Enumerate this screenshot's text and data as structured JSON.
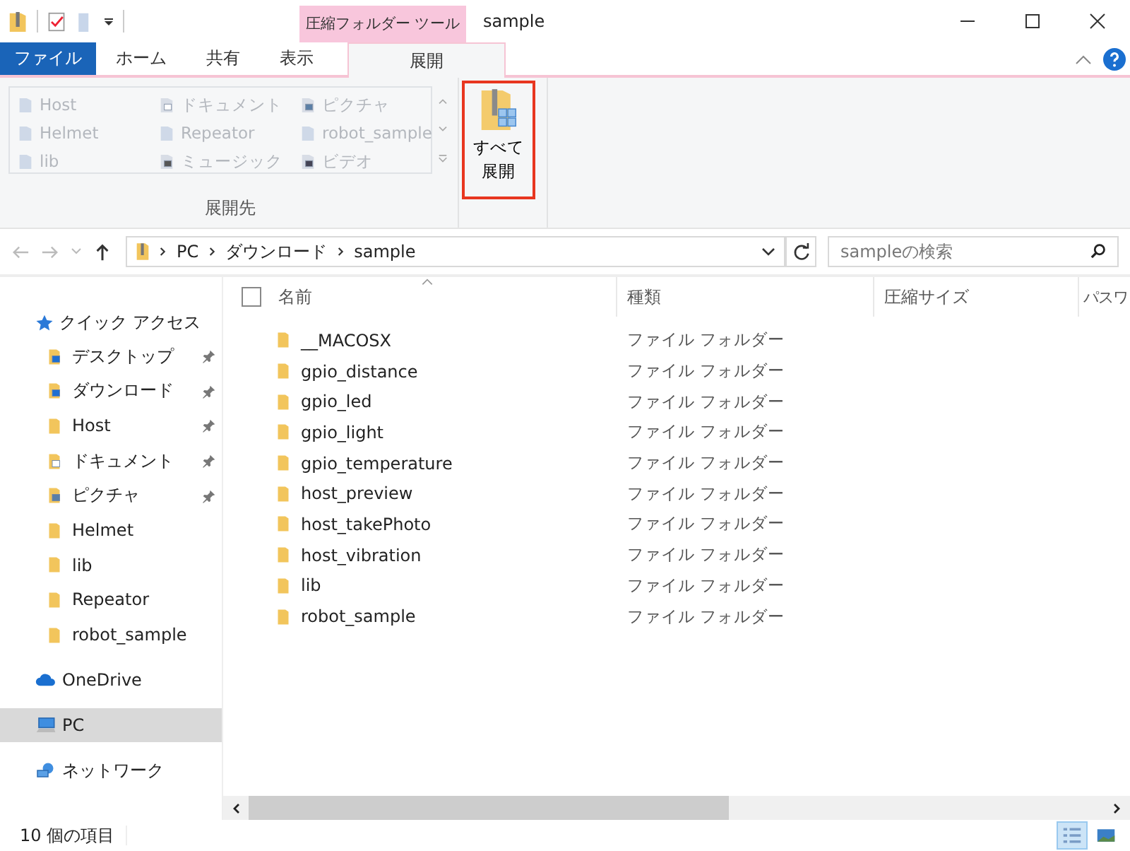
{
  "window": {
    "title": "sample",
    "context_tab_group": "圧縮フォルダー ツール"
  },
  "tabs": [
    {
      "label": "ファイル",
      "kind": "file",
      "selected": false
    },
    {
      "label": "ホーム",
      "kind": "tab",
      "selected": false
    },
    {
      "label": "共有",
      "kind": "tab",
      "selected": false
    },
    {
      "label": "表示",
      "kind": "tab",
      "selected": false
    },
    {
      "label": "展開",
      "kind": "tab",
      "selected": true
    }
  ],
  "ribbon": {
    "destinations": [
      {
        "label": "Host",
        "kind": "folder",
        "disabled": true
      },
      {
        "label": "Helmet",
        "kind": "folder",
        "disabled": true
      },
      {
        "label": "lib",
        "kind": "folder",
        "disabled": true
      },
      {
        "label": "ドキュメント",
        "kind": "documents",
        "disabled": true
      },
      {
        "label": "Repeator",
        "kind": "folder",
        "disabled": true
      },
      {
        "label": "ミュージック",
        "kind": "music",
        "disabled": true
      },
      {
        "label": "ピクチャ",
        "kind": "pictures",
        "disabled": true
      },
      {
        "label": "robot_sample",
        "kind": "folder",
        "disabled": true
      },
      {
        "label": "ビデオ",
        "kind": "video",
        "disabled": true
      }
    ],
    "group_label": "展開先",
    "extract_button": {
      "label_lines": [
        "すべて",
        "展開"
      ],
      "highlighted": true
    }
  },
  "address": {
    "path": [
      "PC",
      "ダウンロード",
      "sample"
    ]
  },
  "search": {
    "placeholder": "sampleの検索"
  },
  "sidebar": {
    "quick_access": {
      "label": "クイック アクセス",
      "items": [
        {
          "label": "デスクトップ",
          "kind": "desktop",
          "pinned": true
        },
        {
          "label": "ダウンロード",
          "kind": "download",
          "pinned": true
        },
        {
          "label": "Host",
          "kind": "folder",
          "pinned": true
        },
        {
          "label": "ドキュメント",
          "kind": "documents",
          "pinned": true
        },
        {
          "label": "ピクチャ",
          "kind": "pictures",
          "pinned": true
        },
        {
          "label": "Helmet",
          "kind": "folder",
          "pinned": false
        },
        {
          "label": "lib",
          "kind": "folder",
          "pinned": false
        },
        {
          "label": "Repeator",
          "kind": "folder",
          "pinned": false
        },
        {
          "label": "robot_sample",
          "kind": "folder",
          "pinned": false
        }
      ]
    },
    "locations": [
      {
        "label": "OneDrive",
        "kind": "cloud",
        "selected": false
      },
      {
        "label": "PC",
        "kind": "pc",
        "selected": true
      },
      {
        "label": "ネットワーク",
        "kind": "network",
        "selected": false
      }
    ]
  },
  "table": {
    "select_all": {
      "checked": false
    },
    "columns": [
      "名前",
      "種類",
      "圧縮サイズ",
      "パスワ"
    ],
    "rows": [
      {
        "name": "__MACOSX",
        "type": "ファイル フォルダー"
      },
      {
        "name": "gpio_distance",
        "type": "ファイル フォルダー"
      },
      {
        "name": "gpio_led",
        "type": "ファイル フォルダー"
      },
      {
        "name": "gpio_light",
        "type": "ファイル フォルダー"
      },
      {
        "name": "gpio_temperature",
        "type": "ファイル フォルダー"
      },
      {
        "name": "host_preview",
        "type": "ファイル フォルダー"
      },
      {
        "name": "host_takePhoto",
        "type": "ファイル フォルダー"
      },
      {
        "name": "host_vibration",
        "type": "ファイル フォルダー"
      },
      {
        "name": "lib",
        "type": "ファイル フォルダー"
      },
      {
        "name": "robot_sample",
        "type": "ファイル フォルダー"
      }
    ]
  },
  "status_bar": {
    "item_count": "10 個の項目",
    "views": [
      {
        "kind": "details",
        "selected": true
      },
      {
        "kind": "thumbnails",
        "selected": false
      }
    ]
  }
}
